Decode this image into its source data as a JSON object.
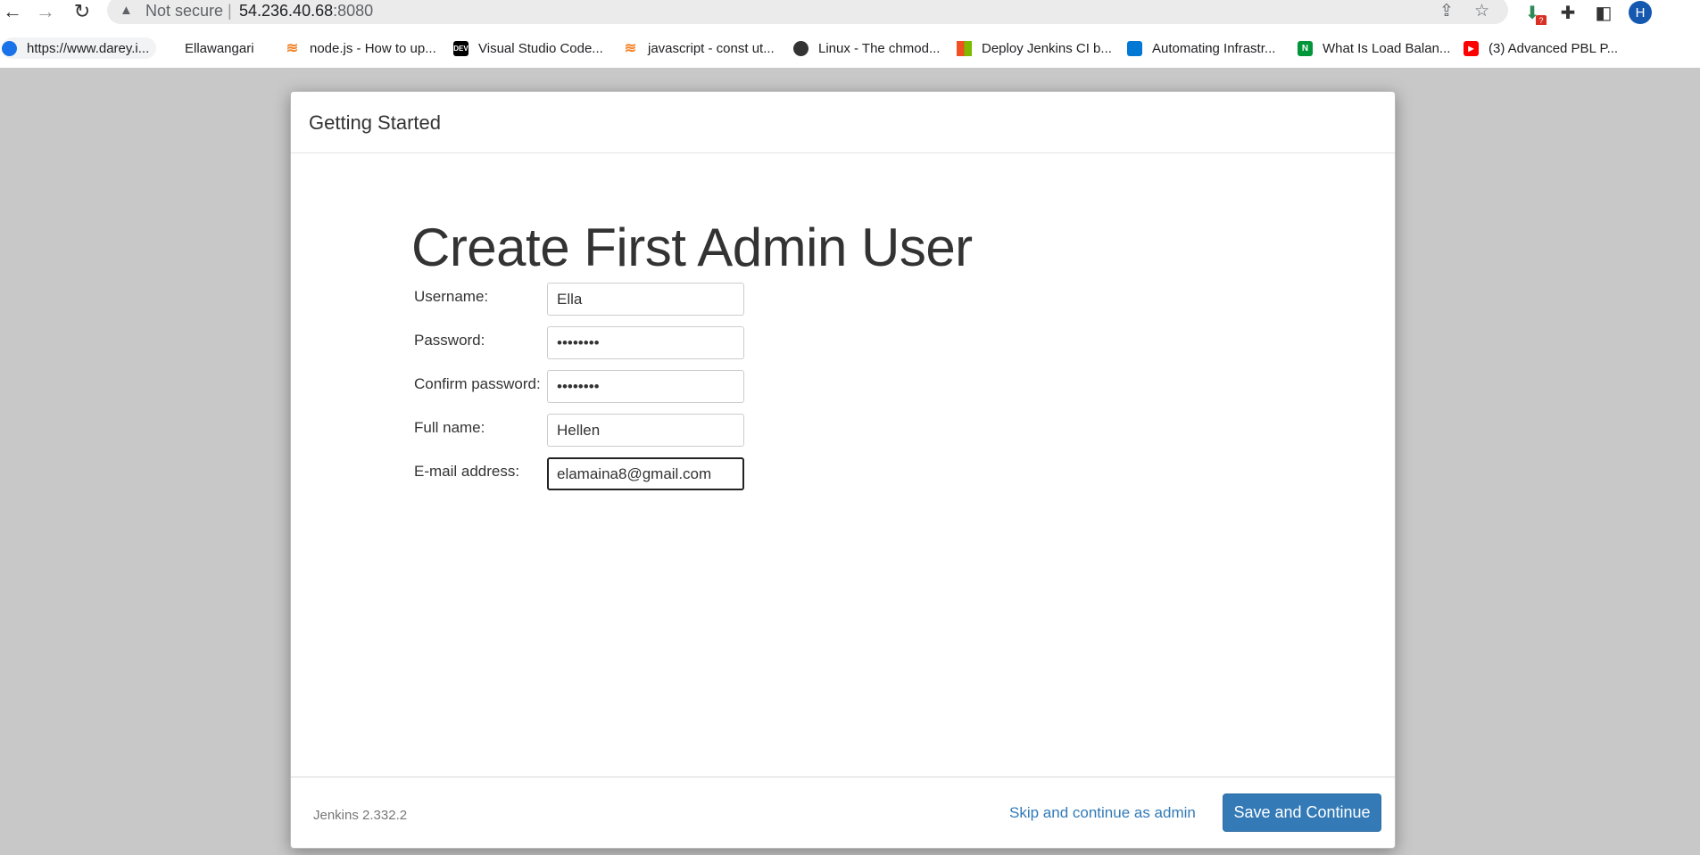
{
  "browser": {
    "security_label": "Not secure",
    "separator": "|",
    "url_host": "54.236.40.68",
    "url_port": ":8080",
    "avatar_letter": "H",
    "extension_badge": "?",
    "bookmarks": [
      {
        "label": "https://www.darey.i...",
        "icon": "darey-icon",
        "color": "#1a73e8"
      },
      {
        "label": "Ellawangari",
        "icon": "folder-icon",
        "color": "#ffffff"
      },
      {
        "label": "node.js - How to up...",
        "icon": "stackoverflow-icon",
        "color": "#f48024"
      },
      {
        "label": "Visual Studio Code...",
        "icon": "dev-icon",
        "color": "#000000"
      },
      {
        "label": "javascript - const ut...",
        "icon": "stackoverflow-icon",
        "color": "#f48024"
      },
      {
        "label": "Linux - The chmod...",
        "icon": "globe-icon",
        "color": "#333333"
      },
      {
        "label": "Deploy Jenkins CI b...",
        "icon": "microsoft-icon",
        "color": "#f25022"
      },
      {
        "label": "Automating Infrastr...",
        "icon": "azure-icon",
        "color": "#0078d4"
      },
      {
        "label": "What Is Load Balan...",
        "icon": "nginx-icon",
        "color": "#009639"
      },
      {
        "label": "(3) Advanced PBL P...",
        "icon": "youtube-icon",
        "color": "#ff0000"
      }
    ]
  },
  "dialog": {
    "header_title": "Getting Started",
    "heading": "Create First Admin User",
    "fields": {
      "username": {
        "label": "Username:",
        "value": "Ella"
      },
      "password": {
        "label": "Password:",
        "value": "••••••••"
      },
      "confirm_password": {
        "label": "Confirm password:",
        "value": "••••••••"
      },
      "full_name": {
        "label": "Full name:",
        "value": "Hellen"
      },
      "email": {
        "label": "E-mail address:",
        "value": "elamaina8@gmail.com"
      }
    },
    "footer": {
      "version": "Jenkins 2.332.2",
      "skip_link": "Skip and continue as admin",
      "save_button": "Save and Continue"
    }
  },
  "colors": {
    "primary_button": "#337ab7",
    "page_background": "#c8c8c8"
  }
}
